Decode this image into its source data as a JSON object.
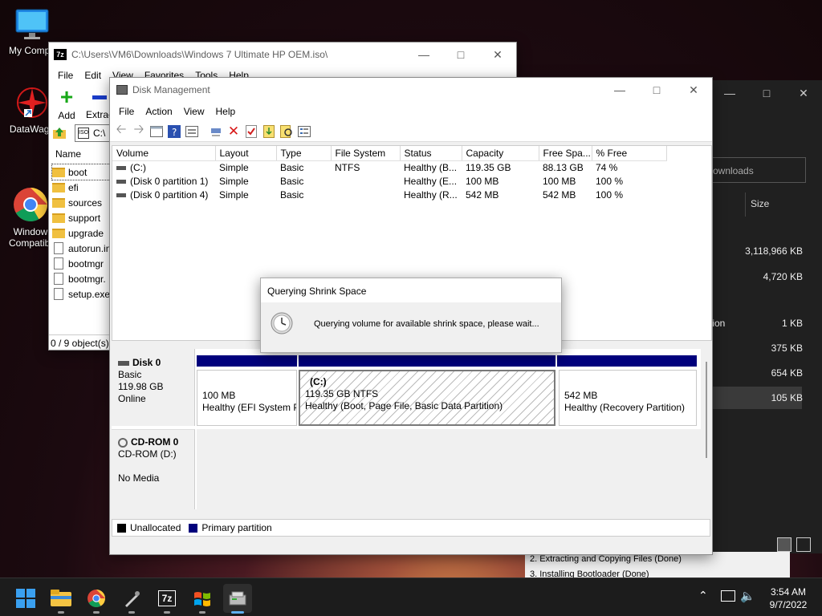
{
  "desktop": {
    "icons": [
      {
        "label": "My Compu"
      },
      {
        "label": "DataWago"
      },
      {
        "label": "Window\nCompatibi"
      }
    ]
  },
  "zip_window": {
    "title": "C:\\Users\\VM6\\Downloads\\Windows 7 Ultimate HP OEM.iso\\",
    "menu": [
      "File",
      "Edit",
      "View",
      "Favorites",
      "Tools",
      "Help"
    ],
    "toolbar": {
      "add": "Add",
      "extract": "Extrac"
    },
    "address": "C:\\",
    "column_name": "Name",
    "files": [
      "boot",
      "efi",
      "sources",
      "support",
      "upgrade",
      "autorun.in",
      "bootmgr",
      "bootmgr.",
      "setup.exe"
    ],
    "status": "0 / 9 object(s)"
  },
  "dark_window": {
    "search_placeholder": "ownloads",
    "column_size": "Size",
    "sizes": [
      "3,118,966 KB",
      "4,720 KB",
      "1 KB",
      "375 KB",
      "654 KB",
      "105 KB"
    ],
    "partial_label": "tion",
    "log_lines": [
      "2. Extracting and Copying Files (Done)",
      "3. Installing Bootloader (Done)"
    ]
  },
  "disk_mgmt": {
    "title": "Disk Management",
    "menu": [
      "File",
      "Action",
      "View",
      "Help"
    ],
    "columns": [
      "Volume",
      "Layout",
      "Type",
      "File System",
      "Status",
      "Capacity",
      "Free Spa...",
      "% Free"
    ],
    "rows": [
      [
        "(C:)",
        "Simple",
        "Basic",
        "NTFS",
        "Healthy (B...",
        "119.35 GB",
        "88.13 GB",
        "74 %"
      ],
      [
        "(Disk 0 partition 1)",
        "Simple",
        "Basic",
        "",
        "Healthy (E...",
        "100 MB",
        "100 MB",
        "100 %"
      ],
      [
        "(Disk 0 partition 4)",
        "Simple",
        "Basic",
        "",
        "Healthy (R...",
        "542 MB",
        "542 MB",
        "100 %"
      ]
    ],
    "disk0": {
      "name": "Disk 0",
      "type": "Basic",
      "size": "119.98 GB",
      "state": "Online"
    },
    "partitions": [
      {
        "size": "100 MB",
        "status": "Healthy (EFI System P"
      },
      {
        "name": "(C:)",
        "size": "119.35 GB NTFS",
        "status": "Healthy (Boot, Page File, Basic Data Partition)"
      },
      {
        "size": "542 MB",
        "status": "Healthy (Recovery Partition)"
      }
    ],
    "cdrom": {
      "name": "CD-ROM 0",
      "type": "CD-ROM (D:)",
      "media": "No Media"
    },
    "legend": {
      "unallocated": "Unallocated",
      "primary": "Primary partition"
    }
  },
  "dialog": {
    "title": "Querying Shrink Space",
    "message": "Querying volume for available shrink space, please wait..."
  },
  "taskbar": {
    "time": "3:54 AM",
    "date": "9/7/2022"
  },
  "colors": {
    "primary_partition": "#00007c",
    "accent": "#0078d4"
  }
}
